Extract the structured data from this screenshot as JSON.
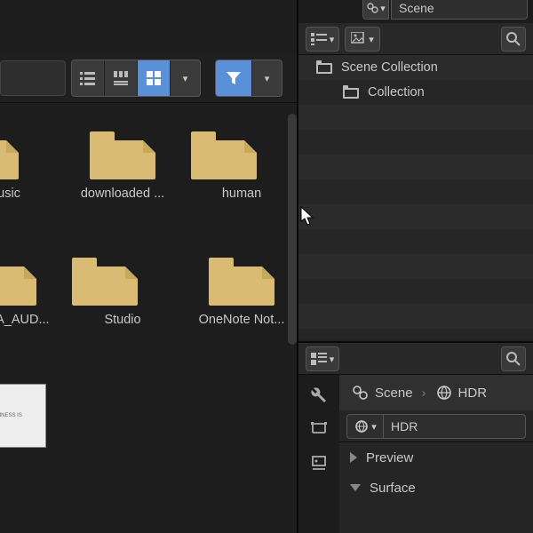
{
  "scene_selector": {
    "value": "Scene"
  },
  "outliner": {
    "rows": [
      {
        "label": "Scene Collection"
      },
      {
        "label": "Collection"
      }
    ]
  },
  "file_browser": {
    "items": [
      {
        "label": "Music",
        "type": "folder",
        "halfcut": true
      },
      {
        "label": "downloaded ...",
        "type": "folder"
      },
      {
        "label": "human",
        "type": "folder",
        "halfcut": true
      },
      {
        "label": "MANDA_AUD...",
        "type": "folder"
      },
      {
        "label": "Studio",
        "type": "folder",
        "halfcut": true
      },
      {
        "label": "OneNote Not...",
        "type": "folder"
      },
      {
        "label": "",
        "type": "image",
        "halfcut": true
      }
    ]
  },
  "properties": {
    "breadcrumb": {
      "scene": "Scene",
      "world": "HDR"
    },
    "datablock": {
      "value": "HDR"
    },
    "sections": {
      "preview": "Preview",
      "surface": "Surface"
    }
  },
  "icons": {
    "list_vertical": "list-vertical",
    "list_horizontal": "list-horizontal",
    "thumbnails": "thumbnails",
    "funnel": "funnel"
  }
}
